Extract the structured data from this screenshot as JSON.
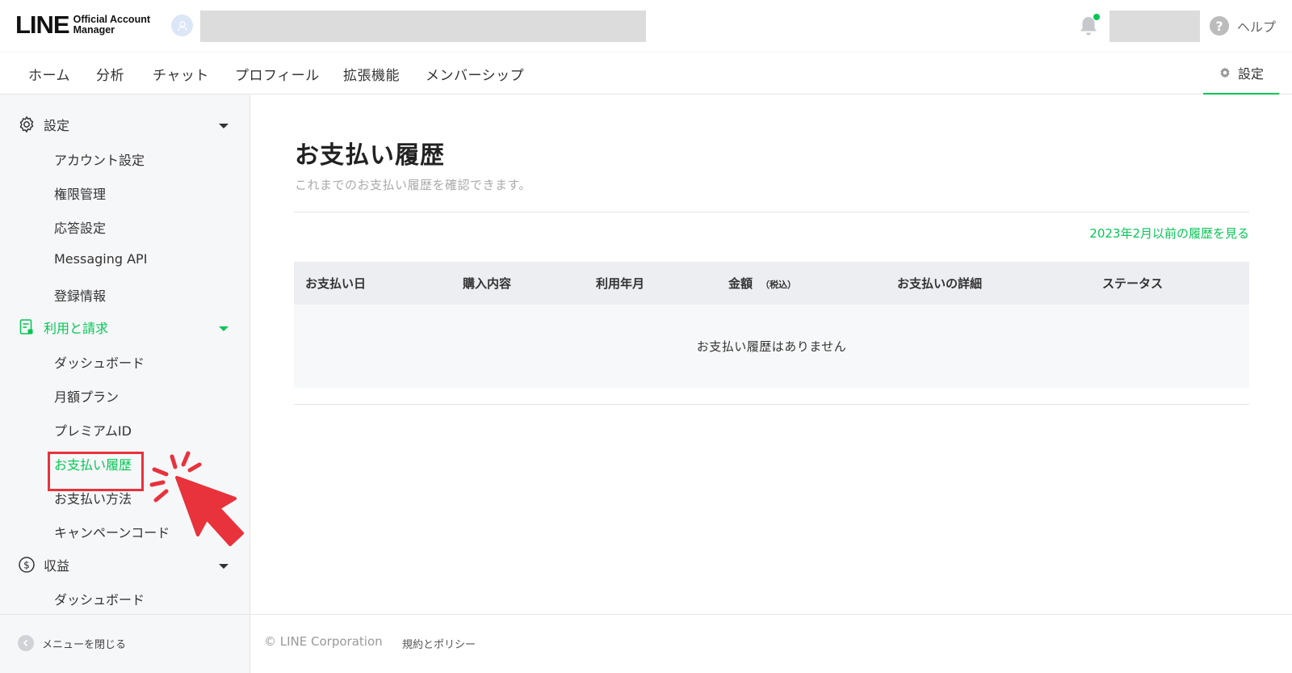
{
  "header": {
    "logo_main": "LINE",
    "logo_sub_line1": "Official Account",
    "logo_sub_line2": "Manager",
    "help_icon_glyph": "?",
    "help_label": "ヘルプ",
    "notification_dot_color": "#06c755"
  },
  "nav": {
    "items": [
      {
        "label": "ホーム"
      },
      {
        "label": "分析"
      },
      {
        "label": "チャット"
      },
      {
        "label": "プロフィール"
      },
      {
        "label": "拡張機能"
      },
      {
        "label": "メンバーシップ"
      }
    ],
    "settings_label": "設定",
    "active_color": "#06c755"
  },
  "sidebar": {
    "sections": [
      {
        "title": "設定",
        "icon": "gear-icon",
        "items": [
          "アカウント設定",
          "権限管理",
          "応答設定",
          "Messaging API",
          "登録情報"
        ]
      },
      {
        "title": "利用と請求",
        "icon": "billing-document-icon",
        "items": [
          "ダッシュボード",
          "月額プラン",
          "プレミアムID",
          "お支払い履歴",
          "お支払い方法",
          "キャンペーンコード"
        ],
        "active_item": "お支払い履歴"
      },
      {
        "title": "収益",
        "icon": "dollar-circle-icon",
        "items": [
          "ダッシュボード"
        ]
      }
    ],
    "close_menu_label": "メニューを閉じる"
  },
  "main": {
    "title": "お支払い履歴",
    "description": "これまでのお支払い履歴を確認できます。",
    "older_history_link": "2023年2月以前の履歴を見る",
    "table": {
      "columns": [
        "お支払い日",
        "購入内容",
        "利用年月",
        "金額",
        "お支払いの詳細",
        "ステータス"
      ],
      "amount_note": "（税込）",
      "empty_message": "お支払い履歴はありません"
    }
  },
  "footer": {
    "copyright": "© LINE Corporation",
    "policy_link": "規約とポリシー"
  },
  "annotation": {
    "highlight_color": "#e8323c"
  }
}
